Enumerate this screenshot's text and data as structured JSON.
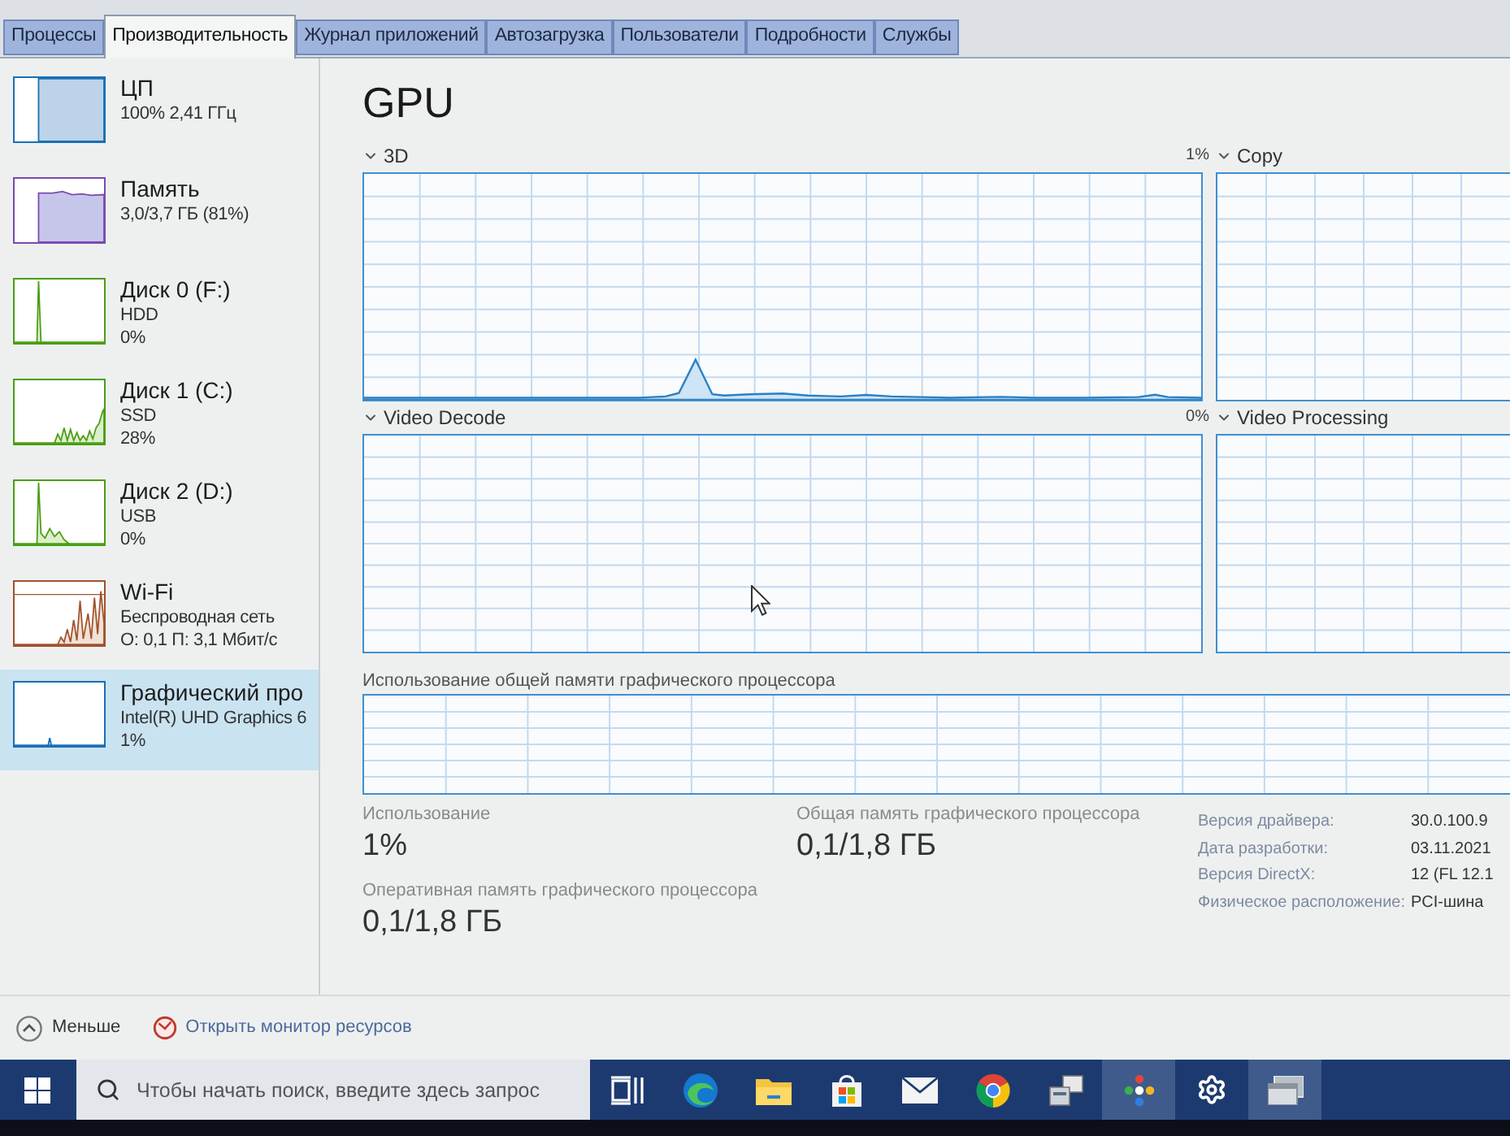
{
  "tabs": [
    {
      "label": "Процессы",
      "selected": false
    },
    {
      "label": "Производительность",
      "selected": true
    },
    {
      "label": "Журнал приложений",
      "selected": false
    },
    {
      "label": "Автозагрузка",
      "selected": false
    },
    {
      "label": "Пользователи",
      "selected": false
    },
    {
      "label": "Подробности",
      "selected": false
    },
    {
      "label": "Службы",
      "selected": false
    }
  ],
  "sidebar": {
    "items": [
      {
        "kind": "cpu",
        "title": "ЦП",
        "lines": [
          "100% 2,41 ГГц"
        ],
        "selected": false
      },
      {
        "kind": "memory",
        "title": "Память",
        "lines": [
          "3,0/3,7 ГБ (81%)"
        ],
        "selected": false
      },
      {
        "kind": "disk",
        "title": "Диск 0 (F:)",
        "lines": [
          "HDD",
          "0%"
        ],
        "selected": false
      },
      {
        "kind": "disk",
        "title": "Диск 1 (C:)",
        "lines": [
          "SSD",
          "28%"
        ],
        "selected": false
      },
      {
        "kind": "disk",
        "title": "Диск 2 (D:)",
        "lines": [
          "USB",
          "0%"
        ],
        "selected": false
      },
      {
        "kind": "network",
        "title": "Wi-Fi",
        "lines": [
          "Беспроводная сеть",
          "О: 0,1 П: 3,1 Мбит/с"
        ],
        "selected": false
      },
      {
        "kind": "gpu",
        "title": "Графический про",
        "lines": [
          "Intel(R) UHD Graphics 6",
          "1%"
        ],
        "selected": true
      }
    ]
  },
  "gpu": {
    "title": "GPU",
    "engine_rows": [
      [
        {
          "name": "3D",
          "reading": "1%"
        },
        {
          "name": "Copy"
        }
      ],
      [
        {
          "name": "Video Decode",
          "reading": "0%"
        },
        {
          "name": "Video Processing"
        }
      ]
    ],
    "shared_memory_label": "Использование общей памяти графического процессора",
    "stats": [
      {
        "label": "Использование",
        "value": "1%"
      },
      {
        "label": "Общая память графического процессора",
        "value": "0,1/1,8 ГБ"
      },
      {
        "label": "Оперативная память графического процессора",
        "value": "0,1/1,8 ГБ"
      }
    ],
    "details": [
      {
        "label": "Версия драйвера:",
        "value": "30.0.100.9"
      },
      {
        "label": "Дата разработки:",
        "value": "03.11.2021"
      },
      {
        "label": "Версия DirectX:",
        "value": "12 (FL 12.1"
      },
      {
        "label": "Физическое расположение:",
        "value": "PCI-шина"
      }
    ]
  },
  "footer": {
    "fewer": "Меньше",
    "resource_monitor": "Открыть монитор ресурсов"
  },
  "taskbar": {
    "search_placeholder": "Чтобы начать поиск, введите здесь запрос",
    "items": [
      {
        "kind": "task_view",
        "active": false
      },
      {
        "kind": "swirl",
        "active": false
      },
      {
        "kind": "folder",
        "active": false
      },
      {
        "kind": "bag",
        "active": false
      },
      {
        "kind": "envelope",
        "active": false
      },
      {
        "kind": "ring",
        "active": false
      },
      {
        "kind": "boxes",
        "active": false
      },
      {
        "kind": "dots",
        "active": true
      },
      {
        "kind": "gear",
        "active": false
      },
      {
        "kind": "window",
        "active": true
      }
    ]
  }
}
